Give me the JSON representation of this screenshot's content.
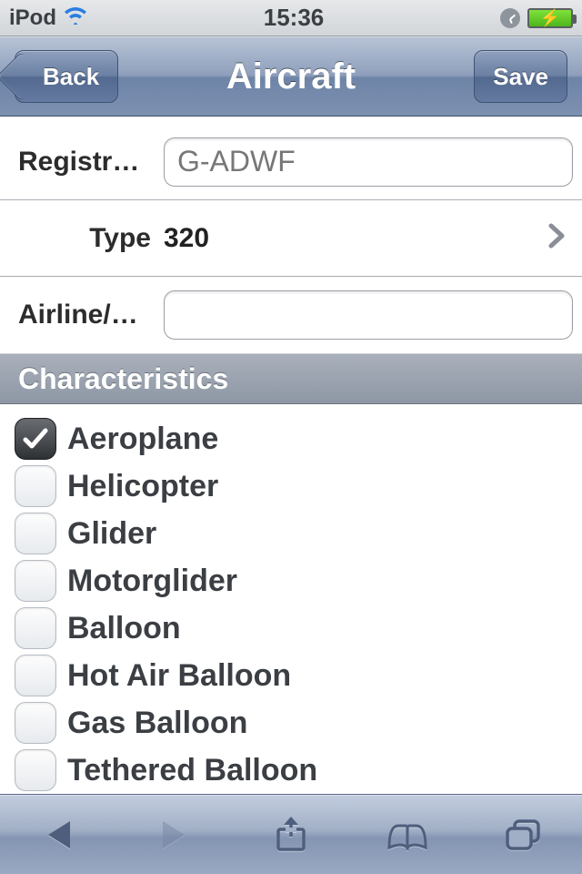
{
  "status": {
    "carrier": "iPod",
    "time": "15:36"
  },
  "nav": {
    "title": "Aircraft",
    "back": "Back",
    "save": "Save"
  },
  "form": {
    "registration": {
      "label": "Registrati...",
      "value": "G-ADWF"
    },
    "type": {
      "label": "Type",
      "value": "320"
    },
    "airline": {
      "label": "Airline/O...",
      "value": ""
    }
  },
  "section": {
    "characteristics": "Characteristics"
  },
  "characteristics": [
    {
      "label": "Aeroplane",
      "checked": true
    },
    {
      "label": "Helicopter",
      "checked": false
    },
    {
      "label": "Glider",
      "checked": false
    },
    {
      "label": "Motorglider",
      "checked": false
    },
    {
      "label": "Balloon",
      "checked": false
    },
    {
      "label": "Hot Air Balloon",
      "checked": false
    },
    {
      "label": "Gas Balloon",
      "checked": false
    },
    {
      "label": "Tethered Balloon",
      "checked": false
    }
  ]
}
